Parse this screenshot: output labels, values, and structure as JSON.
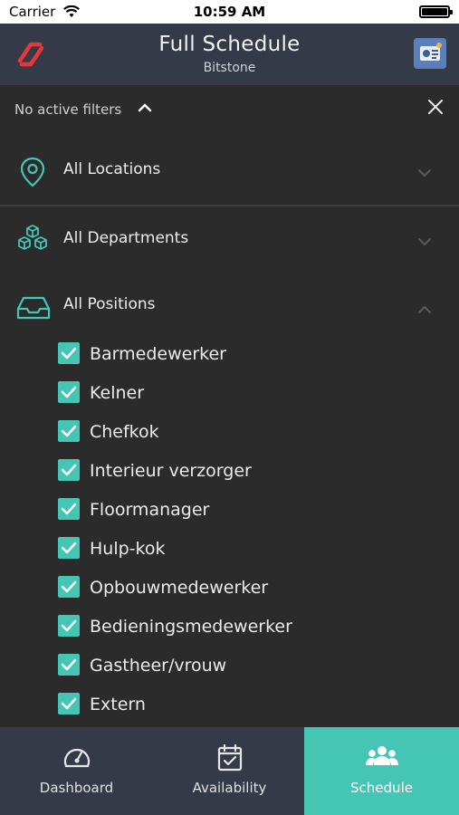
{
  "status_bar": {
    "carrier": "Carrier",
    "time": "10:59 AM"
  },
  "header": {
    "title": "Full Schedule",
    "subtitle": "Bitstone"
  },
  "filters": {
    "label": "No active filters"
  },
  "sections": [
    {
      "label": "All Locations",
      "icon": "location-pin-icon",
      "expanded": false
    },
    {
      "label": "All Departments",
      "icon": "cubes-icon",
      "expanded": false
    },
    {
      "label": "All Positions",
      "icon": "inbox-tray-icon",
      "expanded": true
    }
  ],
  "positions": [
    {
      "label": "Barmedewerker",
      "checked": true
    },
    {
      "label": "Kelner",
      "checked": true
    },
    {
      "label": "Chefkok",
      "checked": true
    },
    {
      "label": "Interieur verzorger",
      "checked": true
    },
    {
      "label": "Floormanager",
      "checked": true
    },
    {
      "label": "Hulp-kok",
      "checked": true
    },
    {
      "label": "Opbouwmedewerker",
      "checked": true
    },
    {
      "label": "Bedieningsmedewerker",
      "checked": true
    },
    {
      "label": "Gastheer/vrouw",
      "checked": true
    },
    {
      "label": "Extern",
      "checked": true
    }
  ],
  "tabs": [
    {
      "label": "Dashboard",
      "icon": "speedometer-icon",
      "active": false
    },
    {
      "label": "Availability",
      "icon": "calendar-check-icon",
      "active": false
    },
    {
      "label": "Schedule",
      "icon": "team-icon",
      "active": true
    }
  ],
  "colors": {
    "accent": "#45c6b5",
    "header_bg": "#343a47",
    "background": "#2b2b2b",
    "logo_red": "#e5383b"
  }
}
